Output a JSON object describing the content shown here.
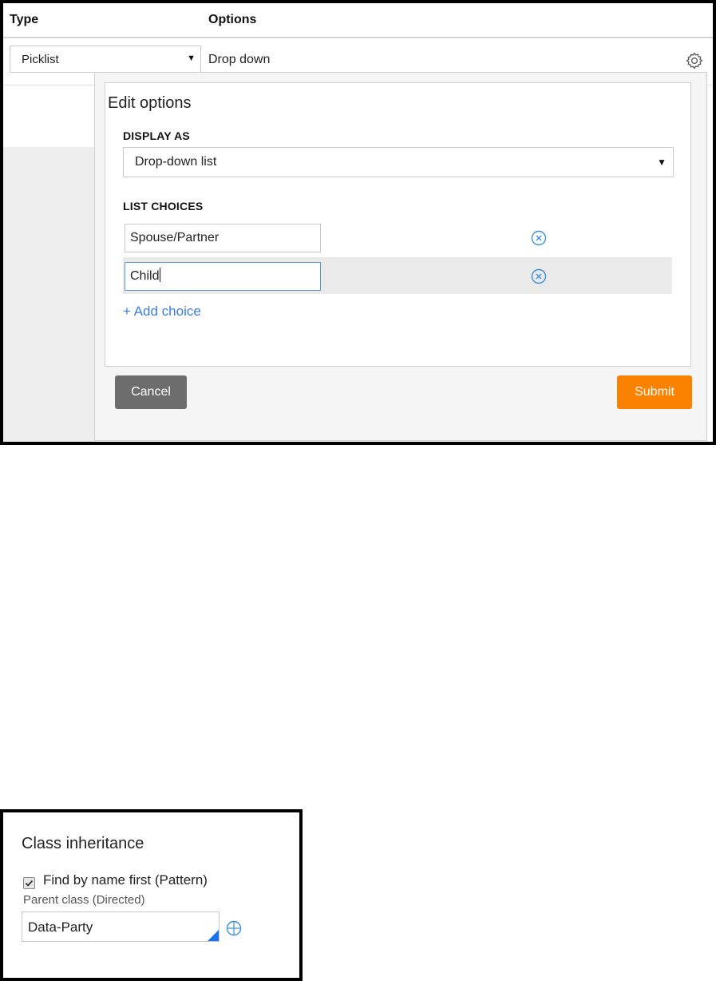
{
  "table": {
    "header_type": "Type",
    "header_options": "Options",
    "type_value": "Picklist",
    "options_value": "Drop down",
    "settings_icon": "gear-icon"
  },
  "edit_options": {
    "title": "Edit options",
    "display_as_label": "DISPLAY AS",
    "display_as_value": "Drop-down list",
    "list_choices_label": "LIST CHOICES",
    "choices": [
      {
        "value": "Spouse/Partner"
      },
      {
        "value": "Child"
      }
    ],
    "add_choice": "+ Add choice",
    "cancel": "Cancel",
    "submit": "Submit",
    "remove_icon": "remove-circle-icon"
  },
  "class_inheritance": {
    "title": "Class inheritance",
    "find_by_name": "Find by name first (Pattern)",
    "find_by_name_checked": true,
    "parent_class_label": "Parent class (Directed)",
    "parent_class_value": "Data-Party",
    "target_icon": "target-icon"
  },
  "colors": {
    "submit": "#fb8200",
    "cancel": "#6d6d6d",
    "link": "#3b7dd8",
    "focus": "#5b9bd5"
  }
}
